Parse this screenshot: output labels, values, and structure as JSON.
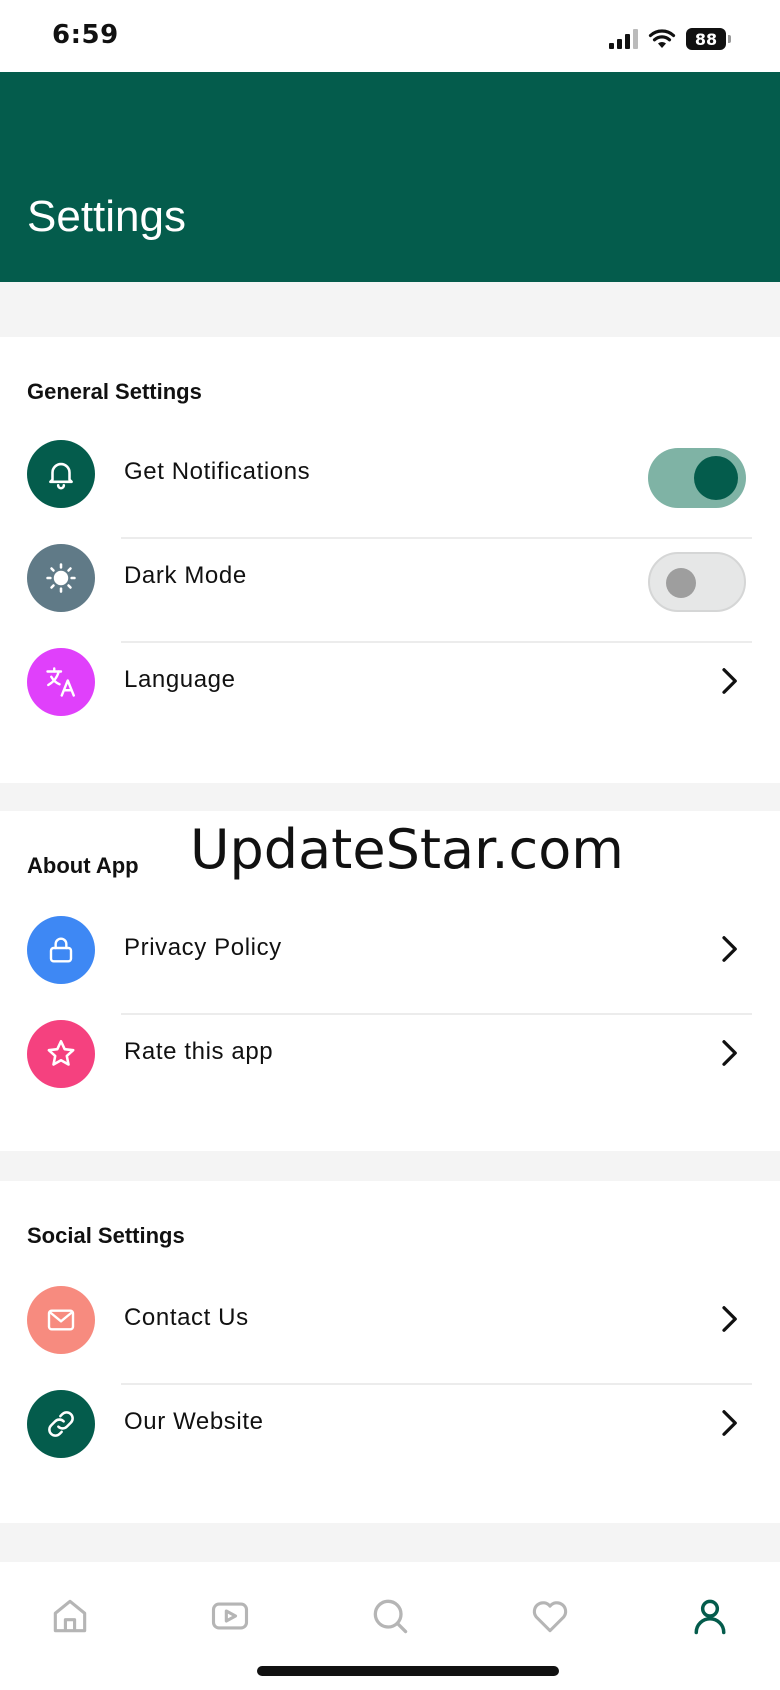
{
  "status_bar": {
    "time": "6:59",
    "battery": "88"
  },
  "header": {
    "title": "Settings"
  },
  "colors": {
    "primary": "#045c4c",
    "notifications_icon_bg": "#045c4c",
    "dark_mode_icon_bg": "#607a87",
    "language_icon_bg": "#e040fb",
    "privacy_icon_bg": "#3e88f4",
    "rate_icon_bg": "#f5417f",
    "contact_icon_bg": "#f78b7f",
    "website_icon_bg": "#045c4c"
  },
  "general": {
    "title": "General Settings",
    "items": [
      {
        "label": "Get Notifications",
        "icon": "bell-icon",
        "control": "toggle",
        "on": true
      },
      {
        "label": "Dark Mode",
        "icon": "sun-icon",
        "control": "toggle",
        "on": false
      },
      {
        "label": "Language",
        "icon": "translate-icon",
        "control": "chevron"
      }
    ]
  },
  "about": {
    "title": "About App",
    "items": [
      {
        "label": "Privacy Policy",
        "icon": "lock-icon",
        "control": "chevron"
      },
      {
        "label": "Rate this app",
        "icon": "star-icon",
        "control": "chevron"
      }
    ]
  },
  "social": {
    "title": "Social Settings",
    "items": [
      {
        "label": "Contact Us",
        "icon": "mail-icon",
        "control": "chevron"
      },
      {
        "label": "Our Website",
        "icon": "link-icon",
        "control": "chevron"
      }
    ]
  },
  "watermark": "UpdateStar.com",
  "bottom_nav": {
    "items": [
      {
        "icon": "home-icon",
        "active": false
      },
      {
        "icon": "video-icon",
        "active": false
      },
      {
        "icon": "search-icon",
        "active": false
      },
      {
        "icon": "heart-icon",
        "active": false
      },
      {
        "icon": "profile-icon",
        "active": true
      }
    ]
  }
}
